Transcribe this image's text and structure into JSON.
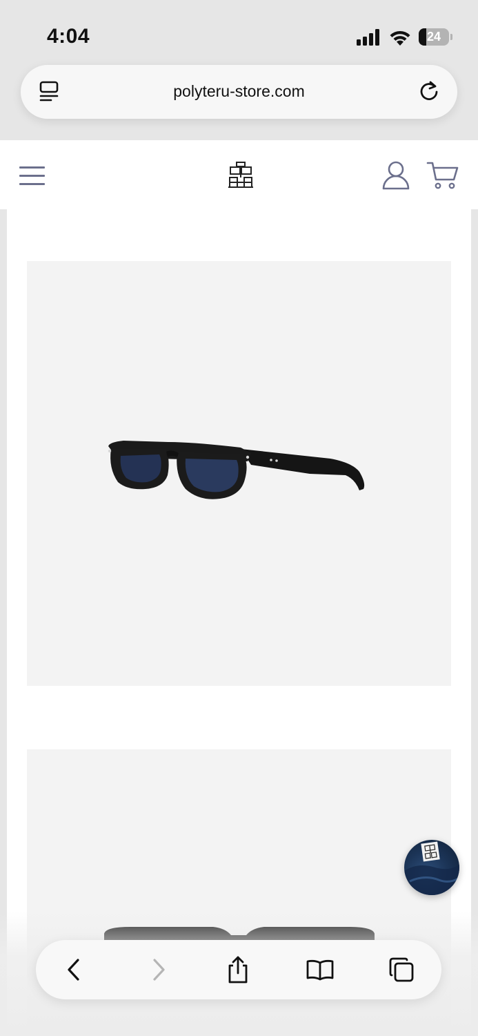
{
  "status_bar": {
    "time": "4:04",
    "battery_level": "24",
    "signal_bars": 4
  },
  "browser": {
    "url": "polyteru-store.com",
    "reader_icon": "page-menu-icon",
    "reload_icon": "reload-icon"
  },
  "site_header": {
    "menu_icon": "hamburger-icon",
    "logo_icon": "brand-logo",
    "account_icon": "user-icon",
    "cart_icon": "cart-icon"
  },
  "products": [
    {
      "image_icon": "black-eyeglasses-side-view"
    },
    {
      "image_icon": "black-eyeglasses-front-view"
    }
  ],
  "toolbar": {
    "back_icon": "chevron-left-icon",
    "forward_icon": "chevron-right-icon",
    "share_icon": "share-icon",
    "bookmarks_icon": "book-icon",
    "tabs_icon": "tabs-icon"
  },
  "colors": {
    "accent": "#6b6f8c",
    "image_bg": "#f3f3f3",
    "chrome_bg": "#e6e6e6"
  }
}
